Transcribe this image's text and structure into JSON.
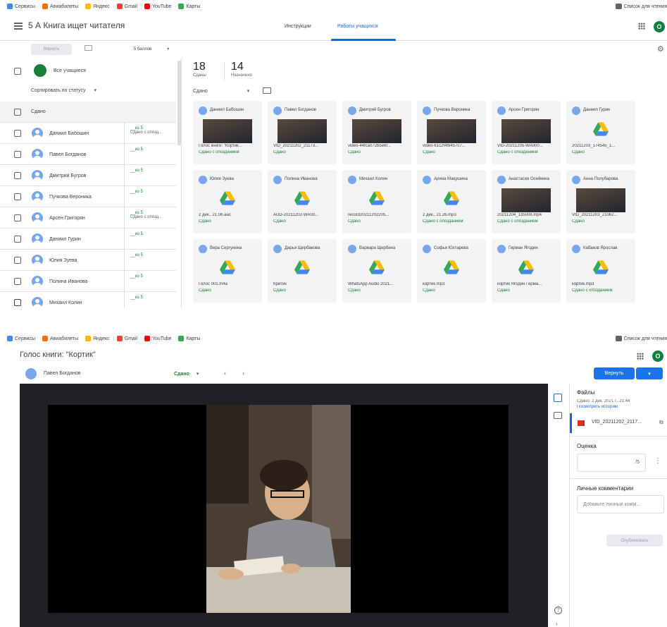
{
  "bookmarks": {
    "items": [
      "Сервисы",
      "Авиабилеты",
      "Яндекс",
      "Gmail",
      "YouTube",
      "Карты"
    ],
    "reading_list": "Список для чтения"
  },
  "classroom": {
    "course_title": "5 А Книга ищет читателя",
    "tabs": [
      "Инструкции",
      "Работы учащихся"
    ],
    "account_initial": "О",
    "return_button": "Вернуть",
    "points": "5 баллов",
    "all_students": "Все учащиеся",
    "sort_label": "Сортировать по статусу",
    "section_header": "Сдано",
    "stats": {
      "turned_in_count": "18",
      "turned_in_label": "Сданы",
      "assigned_count": "14",
      "assigned_label": "Назначено"
    },
    "filter_label": "Сдано",
    "students": [
      {
        "name": "Даниил Бабошин",
        "grade": "__из 5",
        "status": "Сдано с опозд..."
      },
      {
        "name": "Павел Богданов",
        "grade": "__из 5",
        "status": ""
      },
      {
        "name": "Дмитрий Бугров",
        "grade": "__из 5",
        "status": ""
      },
      {
        "name": "Пучкова Вероника",
        "grade": "__из 5",
        "status": ""
      },
      {
        "name": "Арсен Григорян",
        "grade": "__из 5",
        "status": "Сдано с опозд..."
      },
      {
        "name": "Даниил Гурин",
        "grade": "__из 5",
        "status": ""
      },
      {
        "name": "Юлия Зуева",
        "grade": "__из 5",
        "status": ""
      },
      {
        "name": "Полина Иванова",
        "grade": "__из 5",
        "status": ""
      },
      {
        "name": "Михаил Колин",
        "grade": "__из 5",
        "status": ""
      }
    ],
    "cards": [
      {
        "name": "Даниил Бабошин",
        "file": "Голос книги: \"Кортик...",
        "status": "Сдано с опозданием",
        "kind": "video"
      },
      {
        "name": "Павел Богданов",
        "file": "VID_20211202_21173...",
        "status": "Сдано",
        "kind": "video"
      },
      {
        "name": "Дмитрий Бугров",
        "file": "video-44fca072b5e6f...",
        "status": "Сдано",
        "kind": "video"
      },
      {
        "name": "Пучкова Вероника",
        "file": "video-61c2f4f9457c7...",
        "status": "Сдано",
        "kind": "video"
      },
      {
        "name": "Арсен Григорян",
        "file": "VID-20211205-WA000...",
        "status": "Сдано с опозданием",
        "kind": "video"
      },
      {
        "name": "Даниил Гурин",
        "file": "20211203_174545_1...",
        "status": "Сдано",
        "kind": "drive"
      },
      {
        "name": "Юлия Зуева",
        "file": "2 дек., 21.06.aac",
        "status": "Сдано",
        "kind": "drive"
      },
      {
        "name": "Полина Иванова",
        "file": "AUD-20211202-WA00...",
        "status": "Сдано",
        "kind": "drive"
      },
      {
        "name": "Михаил Колин",
        "file": "record20211202205...",
        "status": "Сдано",
        "kind": "drive"
      },
      {
        "name": "Арина Макушина",
        "file": "2 дек., 21.26.mp3",
        "status": "Сдано с опозданием",
        "kind": "drive"
      },
      {
        "name": "Анастасия Осейкина",
        "file": "20211204_135008.mp4",
        "status": "Сдано с опозданием",
        "kind": "video"
      },
      {
        "name": "Анна Полубарова",
        "file": "VID_20211203_21062...",
        "status": "Сдано",
        "kind": "video"
      },
      {
        "name": "Вера Сергунина",
        "file": "Голос 001.m4a",
        "status": "Сдано",
        "kind": "drive"
      },
      {
        "name": "Дарья Щербакова",
        "file": "Критик",
        "status": "Сдано",
        "kind": "drive"
      },
      {
        "name": "Варвара Щербина",
        "file": "WhatsApp Audio 2021...",
        "status": "Сдано",
        "kind": "drive"
      },
      {
        "name": "Софья Юхтарева",
        "file": "кортик.mp3",
        "status": "Сдано",
        "kind": "drive"
      },
      {
        "name": "Герман Ягодин",
        "file": "кортик Ягодин Герма...",
        "status": "Сдано",
        "kind": "drive"
      },
      {
        "name": "Кабаков Ярослав",
        "file": "кортик.mp3",
        "status": "Сдано с опозданием",
        "kind": "drive"
      }
    ]
  },
  "viewer": {
    "title": "Голос книги: \"Кортик\"",
    "account_initial": "О",
    "student_name": "Павел Богданов",
    "status": "Сдано",
    "return_button": "Вернуть",
    "files_heading": "Файлы",
    "submitted_at": "Сдано: 2 дек. 2021 г., 21:44",
    "history_link": "Посмотреть историю",
    "file_name": "VID_20211202_2117...",
    "grade_heading": "Оценка",
    "grade_suffix": "/5",
    "comments_heading": "Личные комментарии",
    "comment_placeholder": "Добавьте личный комм...",
    "publish_button": "Опубликовать"
  },
  "colors": {
    "accent": "#1a73e8",
    "success": "#188038",
    "dark": "#202124"
  }
}
